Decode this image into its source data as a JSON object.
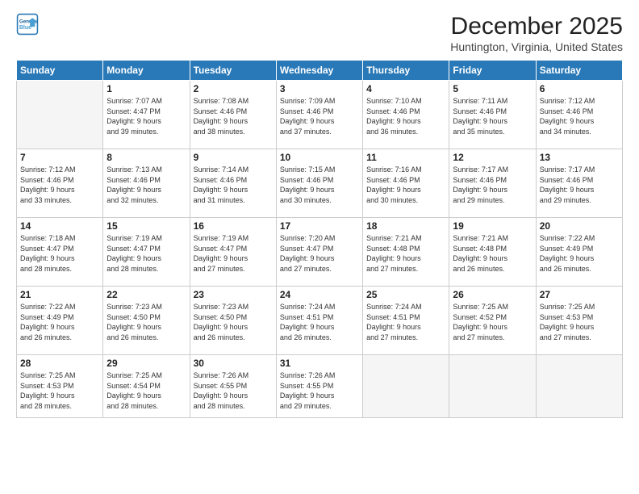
{
  "logo": {
    "line1": "General",
    "line2": "Blue"
  },
  "title": "December 2025",
  "location": "Huntington, Virginia, United States",
  "days_of_week": [
    "Sunday",
    "Monday",
    "Tuesday",
    "Wednesday",
    "Thursday",
    "Friday",
    "Saturday"
  ],
  "weeks": [
    [
      {
        "num": "",
        "empty": true
      },
      {
        "num": "1",
        "sunrise": "7:07 AM",
        "sunset": "4:47 PM",
        "daylight": "9 hours and 39 minutes."
      },
      {
        "num": "2",
        "sunrise": "7:08 AM",
        "sunset": "4:46 PM",
        "daylight": "9 hours and 38 minutes."
      },
      {
        "num": "3",
        "sunrise": "7:09 AM",
        "sunset": "4:46 PM",
        "daylight": "9 hours and 37 minutes."
      },
      {
        "num": "4",
        "sunrise": "7:10 AM",
        "sunset": "4:46 PM",
        "daylight": "9 hours and 36 minutes."
      },
      {
        "num": "5",
        "sunrise": "7:11 AM",
        "sunset": "4:46 PM",
        "daylight": "9 hours and 35 minutes."
      },
      {
        "num": "6",
        "sunrise": "7:12 AM",
        "sunset": "4:46 PM",
        "daylight": "9 hours and 34 minutes."
      }
    ],
    [
      {
        "num": "7",
        "sunrise": "7:12 AM",
        "sunset": "4:46 PM",
        "daylight": "9 hours and 33 minutes."
      },
      {
        "num": "8",
        "sunrise": "7:13 AM",
        "sunset": "4:46 PM",
        "daylight": "9 hours and 32 minutes."
      },
      {
        "num": "9",
        "sunrise": "7:14 AM",
        "sunset": "4:46 PM",
        "daylight": "9 hours and 31 minutes."
      },
      {
        "num": "10",
        "sunrise": "7:15 AM",
        "sunset": "4:46 PM",
        "daylight": "9 hours and 30 minutes."
      },
      {
        "num": "11",
        "sunrise": "7:16 AM",
        "sunset": "4:46 PM",
        "daylight": "9 hours and 30 minutes."
      },
      {
        "num": "12",
        "sunrise": "7:17 AM",
        "sunset": "4:46 PM",
        "daylight": "9 hours and 29 minutes."
      },
      {
        "num": "13",
        "sunrise": "7:17 AM",
        "sunset": "4:46 PM",
        "daylight": "9 hours and 29 minutes."
      }
    ],
    [
      {
        "num": "14",
        "sunrise": "7:18 AM",
        "sunset": "4:47 PM",
        "daylight": "9 hours and 28 minutes."
      },
      {
        "num": "15",
        "sunrise": "7:19 AM",
        "sunset": "4:47 PM",
        "daylight": "9 hours and 28 minutes."
      },
      {
        "num": "16",
        "sunrise": "7:19 AM",
        "sunset": "4:47 PM",
        "daylight": "9 hours and 27 minutes."
      },
      {
        "num": "17",
        "sunrise": "7:20 AM",
        "sunset": "4:47 PM",
        "daylight": "9 hours and 27 minutes."
      },
      {
        "num": "18",
        "sunrise": "7:21 AM",
        "sunset": "4:48 PM",
        "daylight": "9 hours and 27 minutes."
      },
      {
        "num": "19",
        "sunrise": "7:21 AM",
        "sunset": "4:48 PM",
        "daylight": "9 hours and 26 minutes."
      },
      {
        "num": "20",
        "sunrise": "7:22 AM",
        "sunset": "4:49 PM",
        "daylight": "9 hours and 26 minutes."
      }
    ],
    [
      {
        "num": "21",
        "sunrise": "7:22 AM",
        "sunset": "4:49 PM",
        "daylight": "9 hours and 26 minutes."
      },
      {
        "num": "22",
        "sunrise": "7:23 AM",
        "sunset": "4:50 PM",
        "daylight": "9 hours and 26 minutes."
      },
      {
        "num": "23",
        "sunrise": "7:23 AM",
        "sunset": "4:50 PM",
        "daylight": "9 hours and 26 minutes."
      },
      {
        "num": "24",
        "sunrise": "7:24 AM",
        "sunset": "4:51 PM",
        "daylight": "9 hours and 26 minutes."
      },
      {
        "num": "25",
        "sunrise": "7:24 AM",
        "sunset": "4:51 PM",
        "daylight": "9 hours and 27 minutes."
      },
      {
        "num": "26",
        "sunrise": "7:25 AM",
        "sunset": "4:52 PM",
        "daylight": "9 hours and 27 minutes."
      },
      {
        "num": "27",
        "sunrise": "7:25 AM",
        "sunset": "4:53 PM",
        "daylight": "9 hours and 27 minutes."
      }
    ],
    [
      {
        "num": "28",
        "sunrise": "7:25 AM",
        "sunset": "4:53 PM",
        "daylight": "9 hours and 28 minutes."
      },
      {
        "num": "29",
        "sunrise": "7:25 AM",
        "sunset": "4:54 PM",
        "daylight": "9 hours and 28 minutes."
      },
      {
        "num": "30",
        "sunrise": "7:26 AM",
        "sunset": "4:55 PM",
        "daylight": "9 hours and 28 minutes."
      },
      {
        "num": "31",
        "sunrise": "7:26 AM",
        "sunset": "4:55 PM",
        "daylight": "9 hours and 29 minutes."
      },
      {
        "num": "",
        "empty": true
      },
      {
        "num": "",
        "empty": true
      },
      {
        "num": "",
        "empty": true
      }
    ]
  ],
  "labels": {
    "sunrise": "Sunrise:",
    "sunset": "Sunset:",
    "daylight": "Daylight:"
  }
}
